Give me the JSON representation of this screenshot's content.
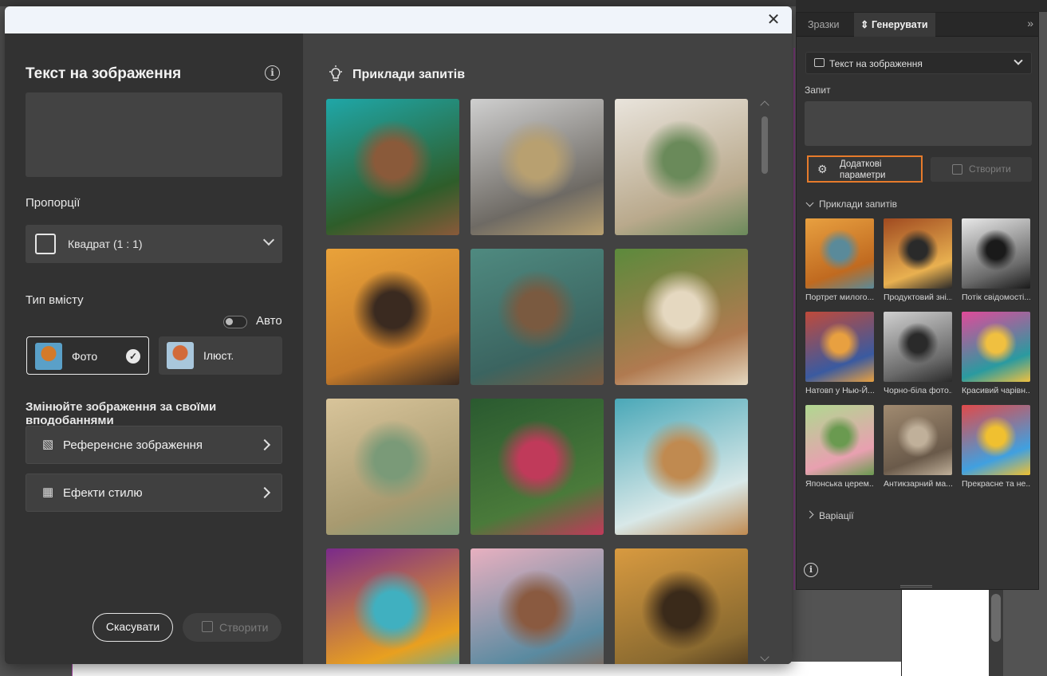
{
  "dialog": {
    "close_glyph": "✕",
    "left": {
      "title": "Текст на зображення",
      "aspect_label": "Пропорції",
      "aspect_value": "Квадрат (1 : 1)",
      "content_type_label": "Тип вмісту",
      "auto_label": "Авто",
      "auto_enabled": false,
      "content_types": [
        {
          "label": "Фото",
          "selected": true
        },
        {
          "label": "Ілюст.",
          "selected": false
        }
      ],
      "customize_heading": "Змінюйте зображення за своїми вподобаннями",
      "rows": [
        {
          "label": "Референсне зображення",
          "icon": "image-reference-icon"
        },
        {
          "label": "Ефекти стилю",
          "icon": "style-effects-icon"
        }
      ],
      "cancel_label": "Скасувати",
      "create_label": "Створити"
    },
    "right": {
      "title": "Приклади запитів",
      "samples": [
        {
          "name": "aerial-island-house",
          "colors": [
            "#1fa7a8",
            "#2e5d2a",
            "#8a5a3a"
          ]
        },
        {
          "name": "bulldog-with-crown",
          "colors": [
            "#cfcfcf",
            "#6e6a64",
            "#b8a070"
          ]
        },
        {
          "name": "modern-living-room",
          "colors": [
            "#e9e4dc",
            "#b9a98c",
            "#6a8a5a"
          ]
        },
        {
          "name": "giraffe-with-sunglasses",
          "colors": [
            "#e9a23a",
            "#c47a2a",
            "#3a2a20"
          ]
        },
        {
          "name": "underwater-ship",
          "colors": [
            "#4f8a80",
            "#3b6460",
            "#7a5a40"
          ]
        },
        {
          "name": "jungle-patio",
          "colors": [
            "#5c8a3c",
            "#b07a50",
            "#e5d8c0"
          ]
        },
        {
          "name": "teapot-and-bottle",
          "colors": [
            "#d8c49a",
            "#a89a70",
            "#7a9a78"
          ]
        },
        {
          "name": "jungle-statue",
          "colors": [
            "#2a5a30",
            "#4a7a3a",
            "#c03a5a"
          ]
        },
        {
          "name": "coffee-cup-lake",
          "colors": [
            "#4aa8b8",
            "#d8e8e8",
            "#c08a50"
          ]
        },
        {
          "name": "woman-portrait-pop",
          "colors": [
            "#7a2a8a",
            "#e8a020",
            "#40b0c0"
          ]
        },
        {
          "name": "blossom-river",
          "colors": [
            "#e8b0c0",
            "#5a8aa0",
            "#8a5a40"
          ]
        },
        {
          "name": "cheetah-savanna",
          "colors": [
            "#d89a40",
            "#8a6a30",
            "#3a2a1a"
          ]
        }
      ]
    }
  },
  "panel": {
    "tabs": [
      "Зразки",
      "Генерувати"
    ],
    "active_tab": "Генерувати",
    "collapse_glyph": "»",
    "mode": "Текст на зображення",
    "prompt_label": "Запит",
    "advanced_label": "Додаткові параметри",
    "create_label": "Створити",
    "examples_label": "Приклади запитів",
    "variations_label": "Варіації",
    "cards": [
      {
        "label": "Портрет милого...",
        "colors": [
          "#e8a040",
          "#c06a20",
          "#5a8a9a"
        ]
      },
      {
        "label": "Продуктовий зні...",
        "colors": [
          "#a04a20",
          "#e8b050",
          "#2a2a2a"
        ]
      },
      {
        "label": "Потік свідомості...",
        "colors": [
          "#e8e8e8",
          "#6a6a6a",
          "#1a1a1a"
        ]
      },
      {
        "label": "Натовп у Нью-Й...",
        "colors": [
          "#c04a3a",
          "#3a5aa0",
          "#e8a040"
        ]
      },
      {
        "label": "Чорно-біла фото...",
        "colors": [
          "#d0d0d0",
          "#6a6a6a",
          "#2a2a2a"
        ]
      },
      {
        "label": "Красивий чарівн...",
        "colors": [
          "#e04a9a",
          "#2a9aa0",
          "#f0c040"
        ]
      },
      {
        "label": "Японська церем...",
        "colors": [
          "#b0d890",
          "#e8a0b0",
          "#6a9a50"
        ]
      },
      {
        "label": "Антикзарний ма...",
        "colors": [
          "#a08a70",
          "#6a5a4a",
          "#c0b09a"
        ]
      },
      {
        "label": "Прекрасне та не...",
        "colors": [
          "#e04a4a",
          "#40a0e0",
          "#f0c030"
        ]
      }
    ]
  }
}
